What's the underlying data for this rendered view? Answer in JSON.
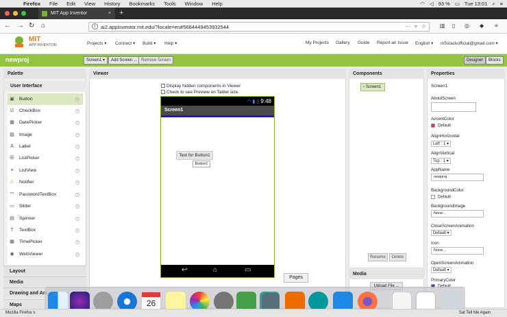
{
  "menubar": {
    "app": "Firefox",
    "items": [
      "File",
      "Edit",
      "View",
      "History",
      "Bookmarks",
      "Tools",
      "Window",
      "Help"
    ],
    "battery": "93 %",
    "clock": "Tue 13:01"
  },
  "browser": {
    "tab_title": "MIT App Inventor",
    "url": "ai2.appinventor.mit.edu/?locale=en#5684449453932544"
  },
  "header": {
    "logo_text": "MIT",
    "logo_sub": "APP INVENTOR",
    "nav": [
      "Projects ▾",
      "Connect ▾",
      "Build ▾",
      "Help ▾"
    ],
    "links": [
      "My Projects",
      "Gallery",
      "Guide",
      "Report an Issue",
      "English ▾",
      "m5stackofficial@gmail.com ▾"
    ]
  },
  "toolbar": {
    "project": "newproj",
    "screen_btn": "Screen1 ▾",
    "add_screen": "Add Screen ...",
    "remove_screen": "Remove Screen",
    "designer": "Designer",
    "blocks": "Blocks"
  },
  "palette": {
    "title": "Palette",
    "category": "User Interface",
    "items": [
      {
        "label": "Button",
        "icon": "▣"
      },
      {
        "label": "CheckBox",
        "icon": "☑"
      },
      {
        "label": "DatePicker",
        "icon": "▦"
      },
      {
        "label": "Image",
        "icon": "▨"
      },
      {
        "label": "Label",
        "icon": "A"
      },
      {
        "label": "ListPicker",
        "icon": "☰"
      },
      {
        "label": "ListView",
        "icon": "≡"
      },
      {
        "label": "Notifier",
        "icon": "⚠"
      },
      {
        "label": "PasswordTextBox",
        "icon": "***"
      },
      {
        "label": "Slider",
        "icon": "▭"
      },
      {
        "label": "Spinner",
        "icon": "▤"
      },
      {
        "label": "TextBox",
        "icon": "T"
      },
      {
        "label": "TimePicker",
        "icon": "▦"
      },
      {
        "label": "WebViewer",
        "icon": "◉"
      }
    ],
    "categories": [
      "Layout",
      "Media",
      "Drawing and Ani",
      "Maps"
    ]
  },
  "viewer": {
    "title": "Viewer",
    "hidden_cb": "Display hidden components in Viewer",
    "tablet_cb": "Check to see Preview on Tablet size.",
    "time": "9:48",
    "screen_title": "Screen1",
    "button_text": "Text for Button1",
    "tooltip": "Button1",
    "pages_btn": "Pages"
  },
  "components": {
    "title": "Components",
    "root": "Screen1",
    "rename": "Rename",
    "delete": "Delete"
  },
  "media": {
    "title": "Media",
    "upload": "Upload File ..."
  },
  "properties": {
    "title": "Properties",
    "component": "Screen1",
    "about": "AboutScreen",
    "accent_label": "AccentColor",
    "accent_val": "Default",
    "accent_color": "#e0307a",
    "align_h_label": "AlignHorizontal",
    "align_h_val": "Left : 1 ▾",
    "align_v_label": "AlignVertical",
    "align_v_val": "Top : 1 ▾",
    "appname_label": "AppName",
    "appname_val": "newproj",
    "bg_label": "BackgroundColor",
    "bg_val": "Default",
    "bgimg_label": "BackgroundImage",
    "bgimg_val": "None...",
    "close_anim_label": "CloseScreenAnimation",
    "close_anim_val": "Default ▾",
    "icon_label": "Icon",
    "icon_val": "None...",
    "open_anim_label": "OpenScreenAnimation",
    "open_anim_val": "Default ▾",
    "primary_label": "PrimaryColor",
    "primary_val": "Default",
    "primary_color": "#3f51b5"
  },
  "statusbar": {
    "left": "Mozilla Firefox s",
    "right": "Sat Tell Me Again"
  }
}
